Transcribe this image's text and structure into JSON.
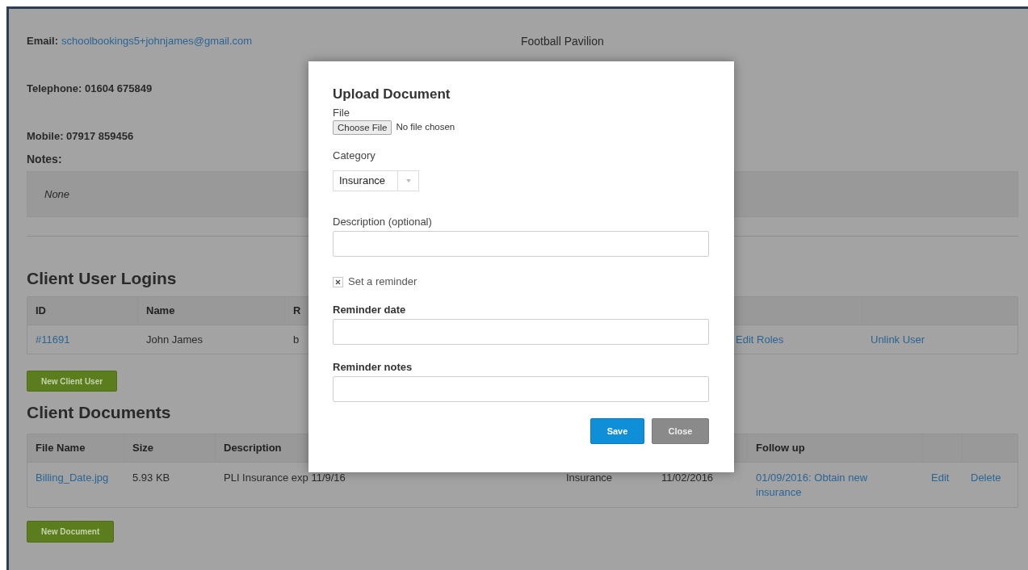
{
  "contact": {
    "email": {
      "label": "Email:",
      "value": "schoolbookings5+johnjames@gmail.com"
    },
    "telephone": "Telephone: 01604 675849",
    "mobile": "Mobile: 07917 859456",
    "notes_label": "Notes:",
    "notes": "None"
  },
  "address": [
    "Football Pavilion"
  ],
  "client_user_logins": {
    "title": "Client User Logins",
    "columns": [
      "ID",
      "Name",
      "R"
    ],
    "rows": [
      {
        "cells": [
          {
            "text": "#11691",
            "kind": "link"
          },
          {
            "text": "John James",
            "kind": "text"
          },
          {
            "text": "b",
            "kind": "text"
          },
          {
            "text": "",
            "kind": "text"
          },
          {
            "text": "Edit Roles",
            "kind": "link"
          },
          {
            "text": "Unlink User",
            "kind": "link"
          }
        ]
      }
    ],
    "button": "New Client User"
  },
  "client_documents": {
    "title": "Client Documents",
    "columns": [
      "File Name",
      "Size",
      "Description",
      "",
      "",
      "Follow up"
    ],
    "rows": [
      {
        "cells": [
          {
            "text": "Billing_Date.jpg",
            "kind": "link"
          },
          {
            "text": "5.93 KB",
            "kind": "text"
          },
          {
            "text": "PLI Insurance exp 11/9/16",
            "kind": "text"
          },
          {
            "text": "Insurance",
            "kind": "text"
          },
          {
            "text": "11/02/2016",
            "kind": "text"
          },
          {
            "text": "01/09/2016: Obtain new insurance",
            "kind": "link"
          },
          {
            "text": "Edit",
            "kind": "link"
          },
          {
            "text": "Delete",
            "kind": "link"
          }
        ]
      }
    ],
    "button": "New Document"
  },
  "dialog": {
    "title": "Upload Document",
    "file_label": "File",
    "file_button": "Choose File",
    "file_status": "No file chosen",
    "category_label": "Category",
    "category_value": "Insurance",
    "description_label": "Description (optional)",
    "reminder": {
      "label": "Set a reminder",
      "checked": true
    },
    "reminder_date_label": "Reminder date",
    "reminder_notes_label": "Reminder notes",
    "buttons": [
      {
        "label": "Save",
        "kind": "primary"
      },
      {
        "label": "Close",
        "kind": "secondary"
      }
    ]
  }
}
